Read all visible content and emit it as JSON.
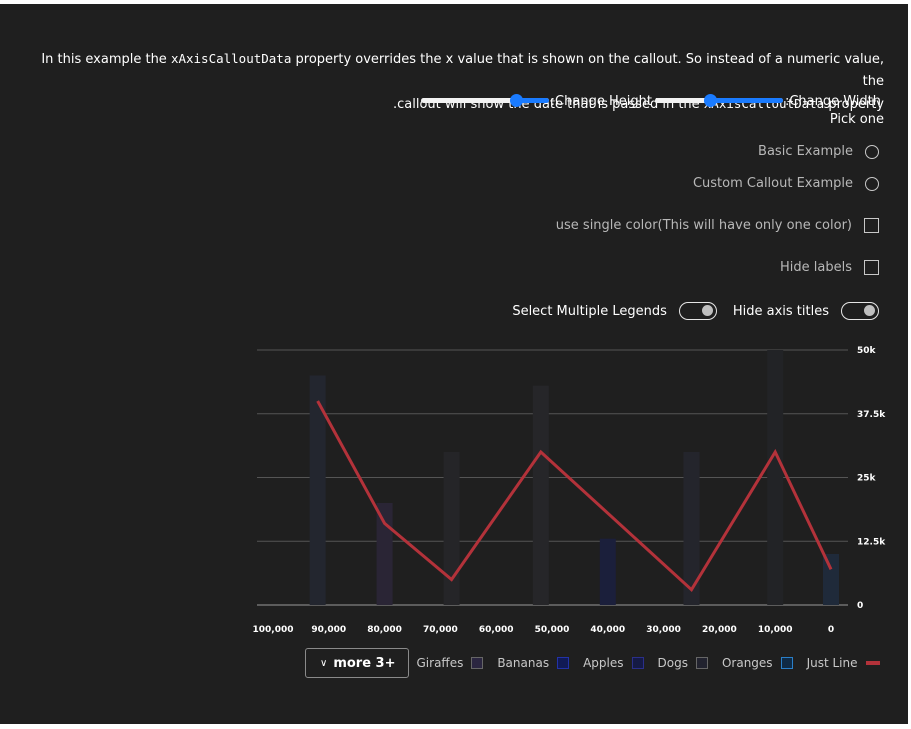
{
  "description": {
    "line1_pre": "In this example the ",
    "line1_code": "xAxisCalloutData",
    "line1_post": " property overrides the x value that is shown on the callout. So instead of a numeric value, the",
    "line2_pre": ".callout will show the date that is passed in the ",
    "line2_code": "xAxisCalloutData",
    "line2_post": " property"
  },
  "controls": {
    "height_label": ":Change Height",
    "height_value": 0.78,
    "width_label": ":Change Width",
    "width_value": 0.43,
    "pick_label": "Pick one",
    "radio_basic": "Basic Example",
    "radio_custom": "Custom Callout Example",
    "check_single_color": "use single color(This will have only one color)",
    "check_hide_labels": "Hide labels",
    "toggle_multiple_legends": "Select Multiple Legends",
    "toggle_hide_axis_titles": "Hide axis titles"
  },
  "legend": {
    "more_label": "more 3+",
    "items": [
      {
        "name": "Giraffes",
        "color": "#2b2640"
      },
      {
        "name": "Bananas",
        "color": "#111a55"
      },
      {
        "name": "Apples",
        "color": "#151a45"
      },
      {
        "name": "Dogs",
        "color": "#22232f"
      },
      {
        "name": "Oranges",
        "color": "#0f2a45"
      },
      {
        "name": "Just Line",
        "color": "#b3323a"
      }
    ]
  },
  "chart_data": {
    "type": "bar",
    "x_ticks": [
      "100,000",
      "90,000",
      "80,000",
      "70,000",
      "60,000",
      "50,000",
      "40,000",
      "30,000",
      "20,000",
      "10,000",
      "0"
    ],
    "y_ticks": [
      "0",
      "12.5k",
      "25k",
      "37.5k",
      "50k"
    ],
    "xlim": [
      100000,
      0
    ],
    "ylim": [
      0,
      50000
    ],
    "bars": [
      {
        "x": 92000,
        "y": 45000,
        "color": "#23262f"
      },
      {
        "x": 80000,
        "y": 20000,
        "color": "#2a2535"
      },
      {
        "x": 68000,
        "y": 30000,
        "color": "#252528"
      },
      {
        "x": 52000,
        "y": 43000,
        "color": "#262629"
      },
      {
        "x": 40000,
        "y": 13000,
        "color": "#1b1f3b"
      },
      {
        "x": 25000,
        "y": 30000,
        "color": "#24252c"
      },
      {
        "x": 10000,
        "y": 50000,
        "color": "#222326"
      },
      {
        "x": 0,
        "y": 10000,
        "color": "#1f2a3a"
      }
    ],
    "line": {
      "name": "Just Line",
      "color": "#b3323a",
      "points": [
        {
          "x": 92000,
          "y": 40000
        },
        {
          "x": 80000,
          "y": 16000
        },
        {
          "x": 68000,
          "y": 5000
        },
        {
          "x": 52000,
          "y": 30000
        },
        {
          "x": 25000,
          "y": 3000
        },
        {
          "x": 10000,
          "y": 30000
        },
        {
          "x": 0,
          "y": 7000
        }
      ]
    }
  }
}
